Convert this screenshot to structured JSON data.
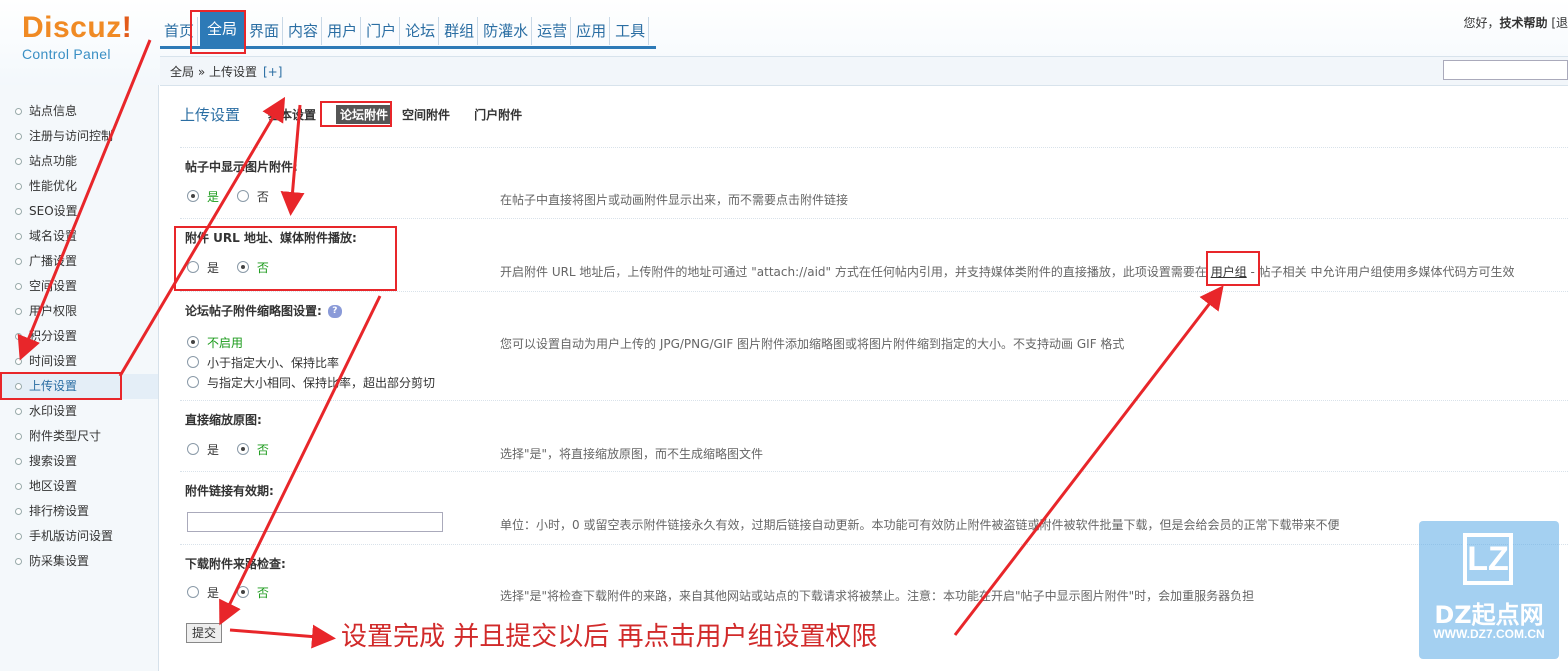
{
  "logo": {
    "brand": "Discuz",
    "bang": "!",
    "sub": "Control Panel"
  },
  "topnav": [
    {
      "label": "首页",
      "active": false
    },
    {
      "label": "全局",
      "active": true
    },
    {
      "label": "界面",
      "active": false
    },
    {
      "label": "内容",
      "active": false
    },
    {
      "label": "用户",
      "active": false
    },
    {
      "label": "门户",
      "active": false
    },
    {
      "label": "论坛",
      "active": false
    },
    {
      "label": "群组",
      "active": false
    },
    {
      "label": "防灌水",
      "active": false
    },
    {
      "label": "运营",
      "active": false
    },
    {
      "label": "应用",
      "active": false
    },
    {
      "label": "工具",
      "active": false
    }
  ],
  "user": {
    "greeting": "您好，",
    "name": "技术帮助",
    "extra": "[退"
  },
  "breadcrumb": {
    "path": "全局 » 上传设置",
    "plus": "[+]"
  },
  "sidebar": [
    {
      "label": "站点信息",
      "active": false
    },
    {
      "label": "注册与访问控制",
      "active": false
    },
    {
      "label": "站点功能",
      "active": false
    },
    {
      "label": "性能优化",
      "active": false
    },
    {
      "label": "SEO设置",
      "active": false
    },
    {
      "label": "域名设置",
      "active": false
    },
    {
      "label": "广播设置",
      "active": false
    },
    {
      "label": "空间设置",
      "active": false
    },
    {
      "label": "用户权限",
      "active": false
    },
    {
      "label": "积分设置",
      "active": false
    },
    {
      "label": "时间设置",
      "active": false
    },
    {
      "label": "上传设置",
      "active": true
    },
    {
      "label": "水印设置",
      "active": false
    },
    {
      "label": "附件类型尺寸",
      "active": false
    },
    {
      "label": "搜索设置",
      "active": false
    },
    {
      "label": "地区设置",
      "active": false
    },
    {
      "label": "排行榜设置",
      "active": false
    },
    {
      "label": "手机版访问设置",
      "active": false
    },
    {
      "label": "防采集设置",
      "active": false
    }
  ],
  "subnav": {
    "title": "上传设置",
    "tabs": [
      {
        "label": "基本设置",
        "active": false
      },
      {
        "label": "论坛附件",
        "active": true
      },
      {
        "label": "空间附件",
        "active": false
      },
      {
        "label": "门户附件",
        "active": false
      }
    ]
  },
  "settings": {
    "s1": {
      "label": "帖子中显示图片附件:",
      "options": [
        {
          "text": "是",
          "checked": true
        },
        {
          "text": "否",
          "checked": false
        }
      ],
      "comment": "在帖子中直接将图片或动画附件显示出来，而不需要点击附件链接"
    },
    "s2": {
      "label": "附件 URL 地址、媒体附件播放:",
      "options": [
        {
          "text": "是",
          "checked": false
        },
        {
          "text": "否",
          "checked": true
        }
      ],
      "comment_a": "开启附件 URL 地址后，上传附件的地址可通过 \"attach://aid\" 方式在任何帖内引用，并支持媒体类附件的直接播放，此项设置需要在 ",
      "comment_link": "用户组",
      "comment_b": " - 帖子相关 中允许用户组使用多媒体代码方可生效"
    },
    "s3": {
      "label": "论坛帖子附件缩略图设置:",
      "help": "?",
      "options": [
        {
          "text": "不启用",
          "checked": true
        },
        {
          "text": "小于指定大小、保持比率",
          "checked": false
        },
        {
          "text": "与指定大小相同、保持比率，超出部分剪切",
          "checked": false
        }
      ],
      "comment": "您可以设置自动为用户上传的 JPG/PNG/GIF 图片附件添加缩略图或将图片附件缩到指定的大小。不支持动画 GIF 格式"
    },
    "s4": {
      "label": "直接缩放原图:",
      "options": [
        {
          "text": "是",
          "checked": false
        },
        {
          "text": "否",
          "checked": true
        }
      ],
      "comment": "选择\"是\"，将直接缩放原图，而不生成缩略图文件"
    },
    "s5": {
      "label": "附件链接有效期:",
      "value": "",
      "comment": "单位：小时，0 或留空表示附件链接永久有效，过期后链接自动更新。本功能可有效防止附件被盗链或附件被软件批量下载，但是会给会员的正常下载带来不便"
    },
    "s6": {
      "label": "下载附件来路检查:",
      "options": [
        {
          "text": "是",
          "checked": false
        },
        {
          "text": "否",
          "checked": true
        }
      ],
      "comment": "选择\"是\"将检查下载附件的来路，来自其他网站或站点的下载请求将被禁止。注意：本功能在开启\"帖子中显示图片附件\"时，会加重服务器负担"
    }
  },
  "submit_label": "提交",
  "annotation": "设置完成  并且提交以后  再点击用户组设置权限",
  "watermark": {
    "logo": "LZ",
    "name": "DZ起点网",
    "url": "WWW.DZ7.COM.CN"
  },
  "colors": {
    "accent": "#2d7ab7",
    "annotation": "#e8262a",
    "green": "#1a9a1a"
  }
}
